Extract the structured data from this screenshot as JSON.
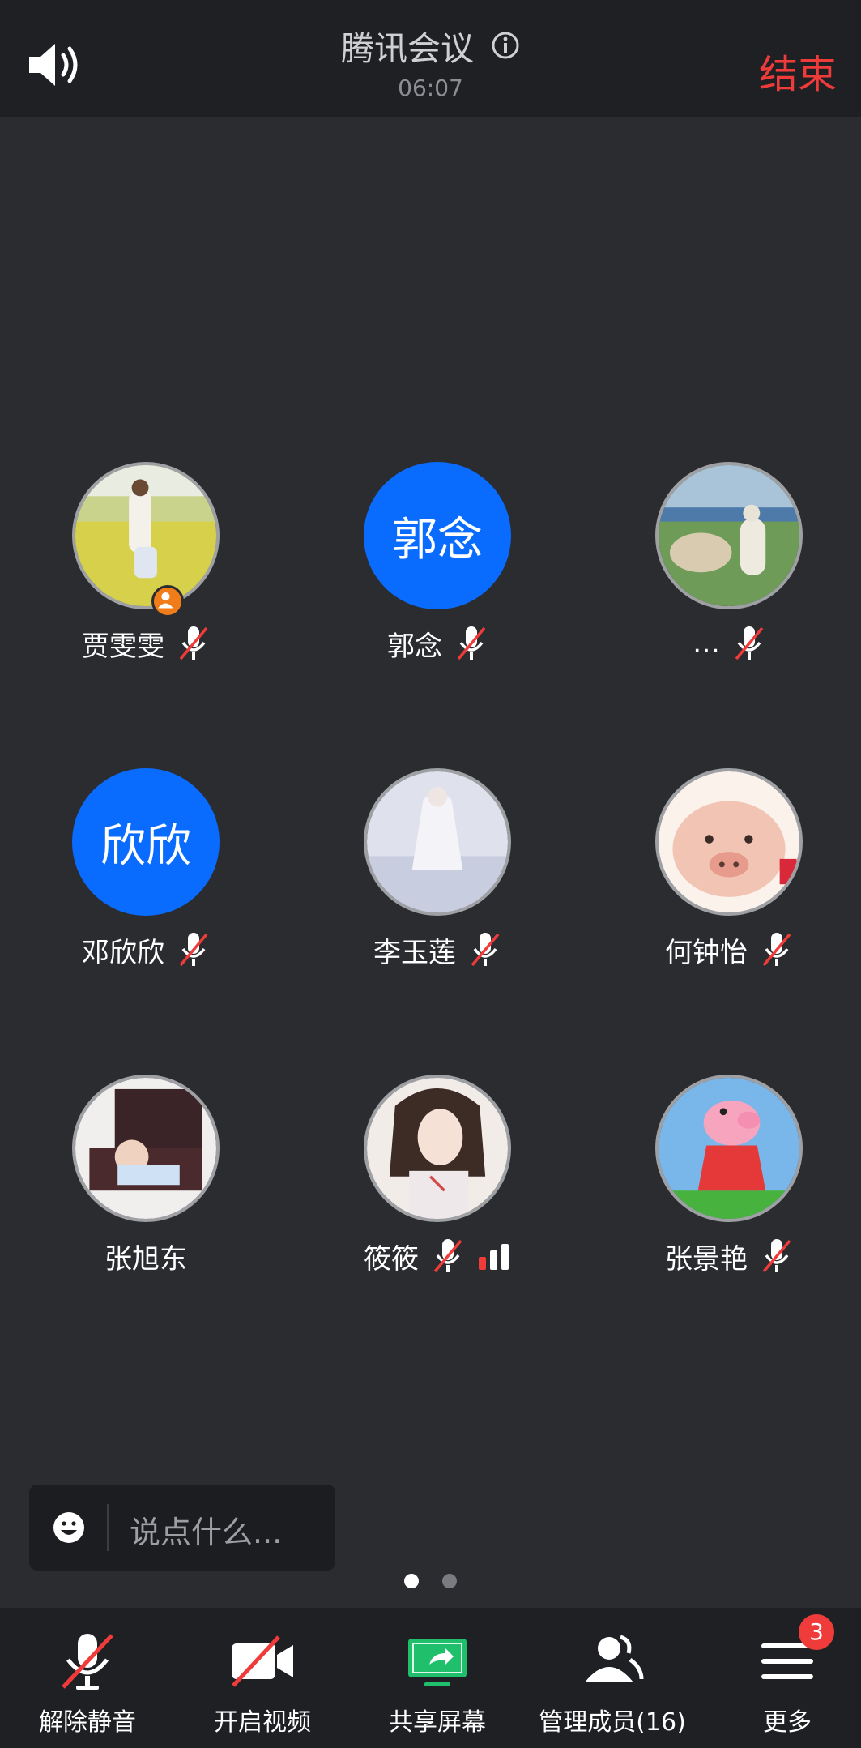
{
  "header": {
    "title": "腾讯会议",
    "timer": "06:07",
    "end_label": "结束"
  },
  "participants": [
    {
      "name": "贾雯雯",
      "avatar_text": "",
      "mic": "muted",
      "host": true
    },
    {
      "name": "郭念",
      "avatar_text": "郭念",
      "mic": "muted"
    },
    {
      "name": "…",
      "avatar_text": "",
      "mic": "muted"
    },
    {
      "name": "邓欣欣",
      "avatar_text": "欣欣",
      "mic": "muted"
    },
    {
      "name": "李玉莲",
      "avatar_text": "",
      "mic": "muted"
    },
    {
      "name": "何钟怡",
      "avatar_text": "",
      "mic": "muted"
    },
    {
      "name": "张旭东",
      "avatar_text": "",
      "mic": "none"
    },
    {
      "name": "筱筱",
      "avatar_text": "",
      "mic": "muted",
      "signal": "weak"
    },
    {
      "name": "张景艳",
      "avatar_text": "",
      "mic": "muted"
    }
  ],
  "chat": {
    "placeholder": "说点什么..."
  },
  "pager": {
    "pages": 2,
    "current": 1
  },
  "toolbar": {
    "unmute_label": "解除静音",
    "video_label": "开启视频",
    "share_label": "共享屏幕",
    "members_label": "管理成员(16)",
    "more_label": "更多",
    "more_badge": "3"
  },
  "colors": {
    "accent_blue": "#0a6cff",
    "end_red": "#f03b3b",
    "share_green": "#1fbf6b",
    "host_orange": "#f07c1a"
  }
}
